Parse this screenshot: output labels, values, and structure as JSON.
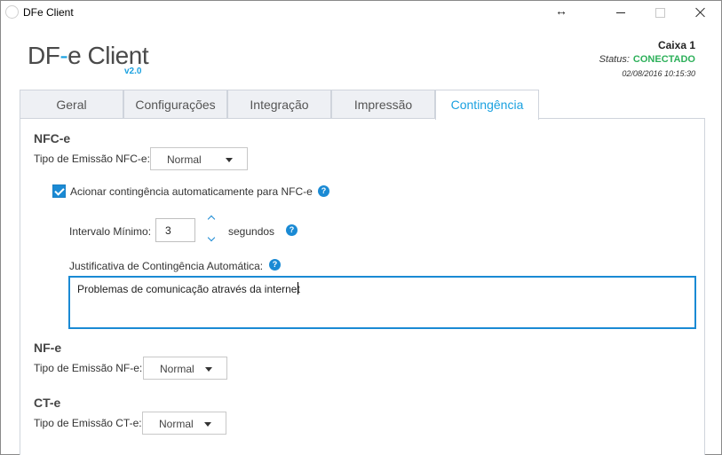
{
  "window": {
    "title": "DFe Client",
    "resize_icon": "↔"
  },
  "header": {
    "logo_main_a": "DF",
    "logo_dash": "-",
    "logo_main_b": "e Client",
    "logo_version": "v2.0",
    "caixa": "Caixa 1",
    "status_label": "Status:",
    "status_value": "CONECTADO",
    "datetime": "02/08/2016 10:15:30",
    "status_color": "#2db05a",
    "accent_color": "#1aa1e0"
  },
  "tabs": [
    {
      "label": "Geral"
    },
    {
      "label": "Configurações"
    },
    {
      "label": "Integração"
    },
    {
      "label": "Impressão"
    },
    {
      "label": "Contingência",
      "active": true
    }
  ],
  "nfce": {
    "title": "NFC-e",
    "tipo_label": "Tipo de Emissão NFC-e:",
    "tipo_value": "Normal",
    "auto_checkbox_label": "Acionar contingência automaticamente para NFC-e",
    "auto_checked": true,
    "intervalo_label": "Intervalo Mínimo:",
    "intervalo_value": "3",
    "intervalo_unit": "segundos",
    "justificativa_label": "Justificativa de Contingência Automática:",
    "justificativa_value": "Problemas de comunicação através da internet"
  },
  "nfe": {
    "title": "NF-e",
    "tipo_label": "Tipo de Emissão NF-e:",
    "tipo_value": "Normal"
  },
  "cte": {
    "title": "CT-e",
    "tipo_label": "Tipo de Emissão CT-e:",
    "tipo_value": "Normal"
  },
  "icons": {
    "help": "?"
  }
}
